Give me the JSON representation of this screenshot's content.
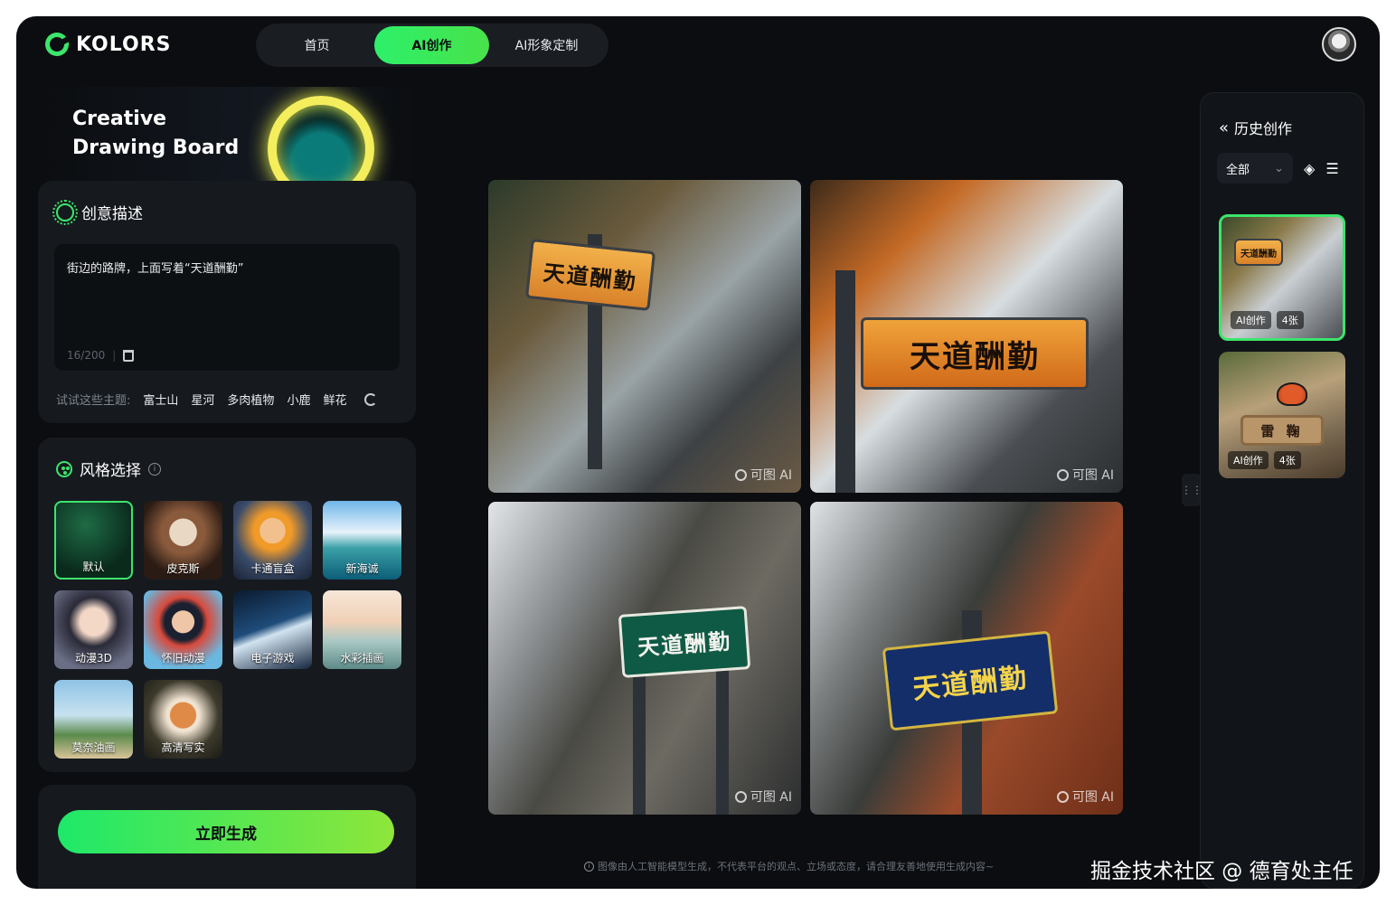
{
  "brand": {
    "name": "KOLORS"
  },
  "nav": {
    "tabs": [
      "首页",
      "AI创作",
      "AI形象定制"
    ],
    "active": "AI创作"
  },
  "banner": {
    "title": "Creative\nDrawing Board"
  },
  "prompt_card": {
    "heading": "创意描述",
    "text": "街边的路牌，上面写着“天道酬勤”",
    "count": "16/200",
    "topics_label": "试试这些主题:",
    "topics": [
      "富士山",
      "星河",
      "多肉植物",
      "小鹿",
      "鲜花"
    ]
  },
  "style_card": {
    "heading": "风格选择",
    "info": "i",
    "styles": [
      "默认",
      "皮克斯",
      "卡通盲盒",
      "新海诚",
      "动漫3D",
      "怀旧动漫",
      "电子游戏",
      "水彩插画",
      "莫奈油画",
      "高清写实"
    ],
    "selected": "默认"
  },
  "generate": {
    "label": "立即生成"
  },
  "images": {
    "sign_text": "天道酬勤",
    "watermark": "可图 AI"
  },
  "disclaimer": "图像由人工智能模型生成，不代表平台的观点、立场或态度，请合理友善地使用生成内容~",
  "history": {
    "title": "历史创作",
    "filter": "全部",
    "items": [
      {
        "sign": "天道酬勤",
        "tag": "AI创作",
        "count": "4张"
      },
      {
        "sign": "雷 鞠",
        "tag": "AI创作",
        "count": "4张"
      }
    ]
  },
  "corner_watermark": "掘金技术社区 @ 德育处主任",
  "colors": {
    "accent": "#3ce56b",
    "background": "#0b0d10",
    "panel": "#161a1f"
  }
}
